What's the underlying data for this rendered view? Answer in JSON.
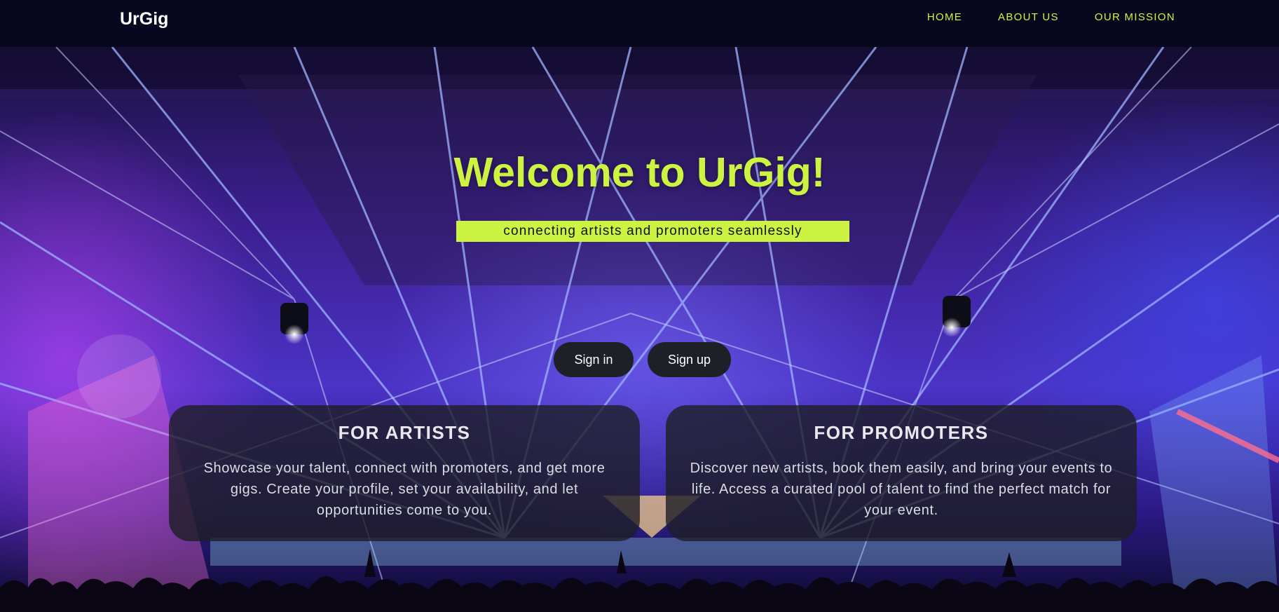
{
  "nav": {
    "brand": "UrGig",
    "links": [
      "HOME",
      "ABOUT US",
      "OUR MISSION"
    ]
  },
  "hero": {
    "title": "Welcome to UrGig!",
    "tagline": "connecting artists and promoters seamlessly",
    "signin_label": "Sign in",
    "signup_label": "Sign up",
    "background": "concert-stage-laser-lights-image"
  },
  "cards": [
    {
      "title": "FOR ARTISTS",
      "body": "Showcase your talent, connect with promoters, and get more gigs. Create your profile, set your availability, and let opportunities come to you."
    },
    {
      "title": "FOR PROMOTERS",
      "body": "Discover new artists, book them easily, and bring your events to life. Access a curated pool of talent to find the perfect match for your event."
    }
  ],
  "colors": {
    "accent": "#cdf342",
    "navbar_bg": "#070720",
    "button_bg": "#1d2026",
    "card_bg": "rgba(30,30,38,0.80)"
  }
}
